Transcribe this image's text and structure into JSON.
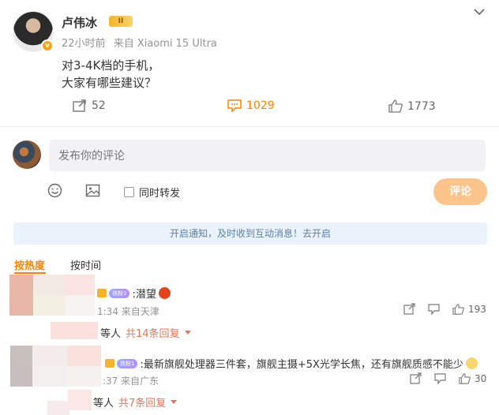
{
  "post": {
    "author": "卢伟冰",
    "level_badge": "II",
    "verified_mark": "v",
    "time": "22小时前",
    "source": "来自 Xiaomi 15 Ultra",
    "text_line1": "对3-4K档的手机，",
    "text_line2": "大家有哪些建议？",
    "repost_count": "52",
    "comment_count": "1029",
    "like_count": "1773"
  },
  "composer": {
    "placeholder": "发布你的评论",
    "forward_label": "同时转发",
    "submit_label": "评论"
  },
  "notice": "开启通知，及时收到互动消息！去开启",
  "tabs": {
    "hot": "按热度",
    "time": "按时间"
  },
  "comments": [
    {
      "fan_badge": "铁粉3",
      "text": ":潜望",
      "meta": "1:34 来自天津",
      "like_count": "193",
      "reply_prefix": "等人",
      "reply_more": "共14条回复"
    },
    {
      "fan_badge": "铁粉1",
      "text": ":最新旗舰处理器三件套，旗舰主摄+5X光学长焦，还有旗舰质感不能少",
      "meta": ":37 来自广东",
      "like_count": "30",
      "reply_prefix": "等人",
      "reply_more": "共7条回复"
    }
  ],
  "colors": {
    "accent": "#ff8200",
    "submit_bg": "#fcc48a",
    "notice_bg": "#eaf3fb"
  }
}
